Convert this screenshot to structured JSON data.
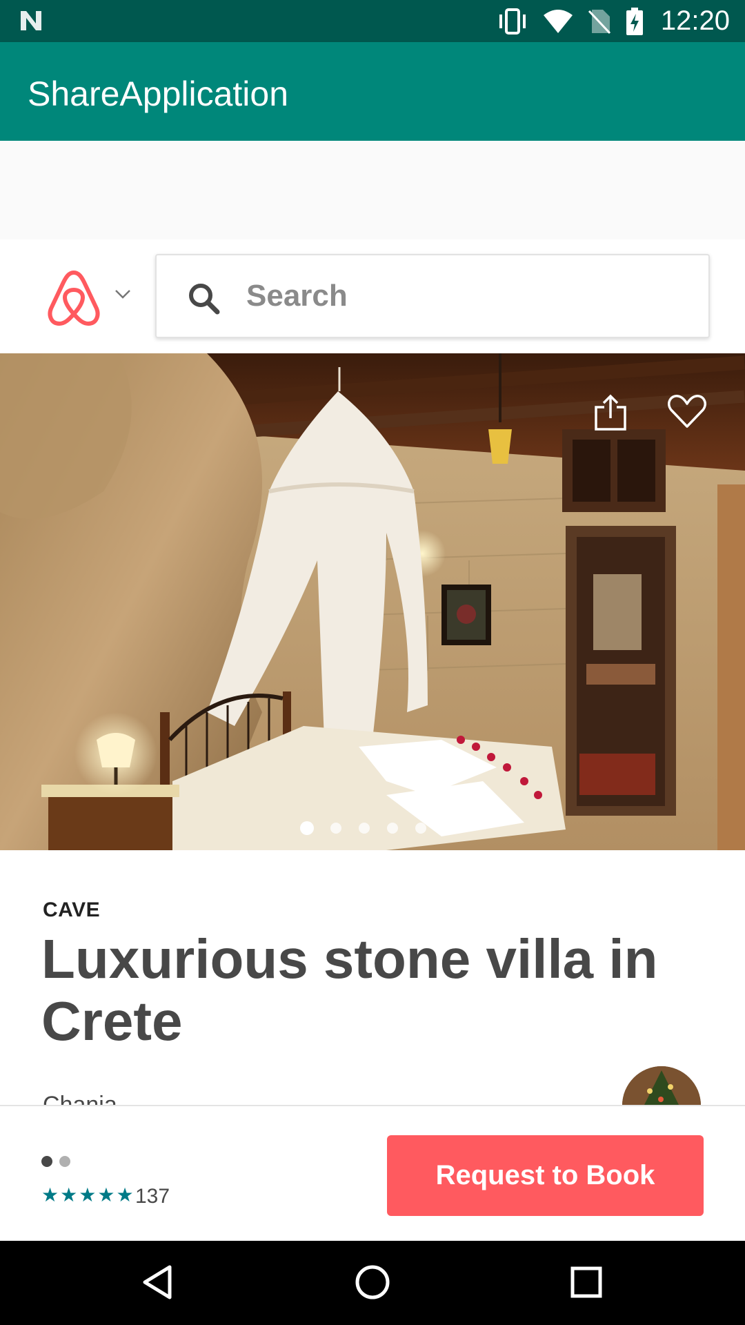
{
  "status_bar": {
    "time": "12:20",
    "icons": [
      "notification-n-icon",
      "vibrate-icon",
      "wifi-icon",
      "no-sim-icon",
      "battery-charging-icon"
    ]
  },
  "app_bar": {
    "title": "ShareApplication"
  },
  "search": {
    "placeholder": "Search",
    "logo": "airbnb-logo-icon",
    "dropdown_icon": "chevron-down-icon"
  },
  "hero": {
    "icons": [
      "share-icon",
      "heart-icon"
    ],
    "page_count": 6,
    "active_page": 1
  },
  "listing": {
    "category": "CAVE",
    "title": "Luxurious stone villa in Crete",
    "city_peek": "Chania"
  },
  "booking": {
    "rating_stars": 5,
    "review_count": "137",
    "button_label": "Request to Book",
    "pager_dots": 2,
    "active_dot": 1
  },
  "colors": {
    "status_bar": "#00584f",
    "app_bar": "#00877a",
    "accent_button": "#ff5a5f",
    "stars": "#007a87",
    "logo": "#ff5a5f"
  },
  "nav_bar": {
    "icons": [
      "back-icon",
      "home-icon",
      "recents-icon"
    ]
  }
}
